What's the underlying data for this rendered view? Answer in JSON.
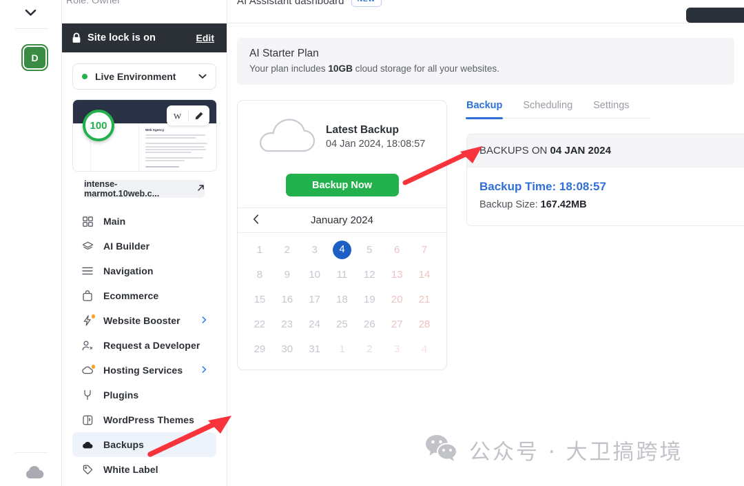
{
  "rail": {
    "chevron_icon": "chevron-down-icon",
    "avatar_initial": "D",
    "bottom_icon": "cloud-icon"
  },
  "sidebar": {
    "role_text": "Role: Owner",
    "site_lock": {
      "icon": "lock-icon",
      "label": "Site lock is on",
      "edit_label": "Edit"
    },
    "environment": {
      "label": "Live Environment",
      "status_color": "#23b14d",
      "caret_icon": "chevron-down-icon"
    },
    "site_preview": {
      "score": "100",
      "score_color": "#22b14c",
      "thumb_heading": "Web Agency",
      "wordpress_icon": "wordpress-w-icon",
      "edit_icon": "pencil-icon",
      "url": "intense-marmot.10web.c...",
      "external_icon": "external-link-icon"
    },
    "items": [
      {
        "label": "Main",
        "icon": "grid-icon",
        "active": false,
        "chevron": false,
        "dot": false
      },
      {
        "label": "AI Builder",
        "icon": "layers-icon",
        "active": false,
        "chevron": false,
        "dot": false
      },
      {
        "label": "Navigation",
        "icon": "menu-lines-icon",
        "active": false,
        "chevron": false,
        "dot": false
      },
      {
        "label": "Ecommerce",
        "icon": "bag-icon",
        "active": false,
        "chevron": false,
        "dot": false
      },
      {
        "label": "Website Booster",
        "icon": "bolt-icon",
        "active": false,
        "chevron": true,
        "dot": true
      },
      {
        "label": "Request a Developer",
        "icon": "person-gear-icon",
        "active": false,
        "chevron": false,
        "dot": false
      },
      {
        "label": "Hosting Services",
        "icon": "cloud-icon",
        "active": false,
        "chevron": true,
        "dot": true
      },
      {
        "label": "Plugins",
        "icon": "plug-icon",
        "active": false,
        "chevron": false,
        "dot": false
      },
      {
        "label": "WordPress Themes",
        "icon": "themes-icon",
        "active": false,
        "chevron": false,
        "dot": false
      },
      {
        "label": "Backups",
        "icon": "cloud-filled-icon",
        "active": true,
        "chevron": false,
        "dot": false
      },
      {
        "label": "White Label",
        "icon": "tag-icon",
        "active": false,
        "chevron": false,
        "dot": false
      }
    ]
  },
  "main": {
    "header": {
      "title": "AI Assistant dashboard",
      "badge": "NEW"
    },
    "plan": {
      "title": "AI Starter Plan",
      "description_prefix": "Your plan includes ",
      "description_bold": "10GB",
      "description_suffix": " cloud storage for all your websites."
    },
    "backup_card": {
      "cloud_icon": "cloud-outline-icon",
      "latest_label": "Latest Backup",
      "latest_date": "04 Jan 2024, 18:08:57",
      "backup_now_label": "Backup Now",
      "backup_now_color": "#22b14c"
    },
    "calendar": {
      "prev_icon": "chevron-left-icon",
      "month": "January 2024",
      "selected_day": 4,
      "selected_color": "#1e5fc4",
      "weeks": [
        [
          {
            "d": "1"
          },
          {
            "d": "2"
          },
          {
            "d": "3"
          },
          {
            "d": "4",
            "sel": true
          },
          {
            "d": "5"
          },
          {
            "d": "6",
            "we": true
          },
          {
            "d": "7",
            "we": true
          }
        ],
        [
          {
            "d": "8"
          },
          {
            "d": "9"
          },
          {
            "d": "10"
          },
          {
            "d": "11"
          },
          {
            "d": "12"
          },
          {
            "d": "13",
            "we": true
          },
          {
            "d": "14",
            "we": true
          }
        ],
        [
          {
            "d": "15"
          },
          {
            "d": "16"
          },
          {
            "d": "17"
          },
          {
            "d": "18"
          },
          {
            "d": "19"
          },
          {
            "d": "20",
            "we": true
          },
          {
            "d": "21",
            "we": true
          }
        ],
        [
          {
            "d": "22"
          },
          {
            "d": "23"
          },
          {
            "d": "24"
          },
          {
            "d": "25"
          },
          {
            "d": "26"
          },
          {
            "d": "27",
            "we": true
          },
          {
            "d": "28",
            "we": true
          }
        ],
        [
          {
            "d": "29"
          },
          {
            "d": "30"
          },
          {
            "d": "31"
          },
          {
            "d": "1",
            "muted": true
          },
          {
            "d": "2",
            "muted": true
          },
          {
            "d": "3",
            "we": true,
            "muted": true
          },
          {
            "d": "4",
            "we": true,
            "muted": true
          }
        ]
      ]
    },
    "tabs": [
      {
        "label": "Backup",
        "active": true
      },
      {
        "label": "Scheduling",
        "active": false
      },
      {
        "label": "Settings",
        "active": false
      }
    ],
    "backups_panel": {
      "header_prefix": "BACKUPS ON ",
      "header_date": "04 JAN 2024",
      "time_label": "Backup Time: 18:08:57",
      "size_prefix": "Backup Size: ",
      "size_value": "167.42MB"
    }
  },
  "watermark": {
    "icon": "wechat-icon",
    "text": "公众号 · 大卫搞跨境"
  },
  "annotations": {
    "arrow_color": "#f9333c",
    "arrow_sidebar": "arrow-pointing-to-backups",
    "arrow_backup": "arrow-pointing-to-backup-card"
  }
}
